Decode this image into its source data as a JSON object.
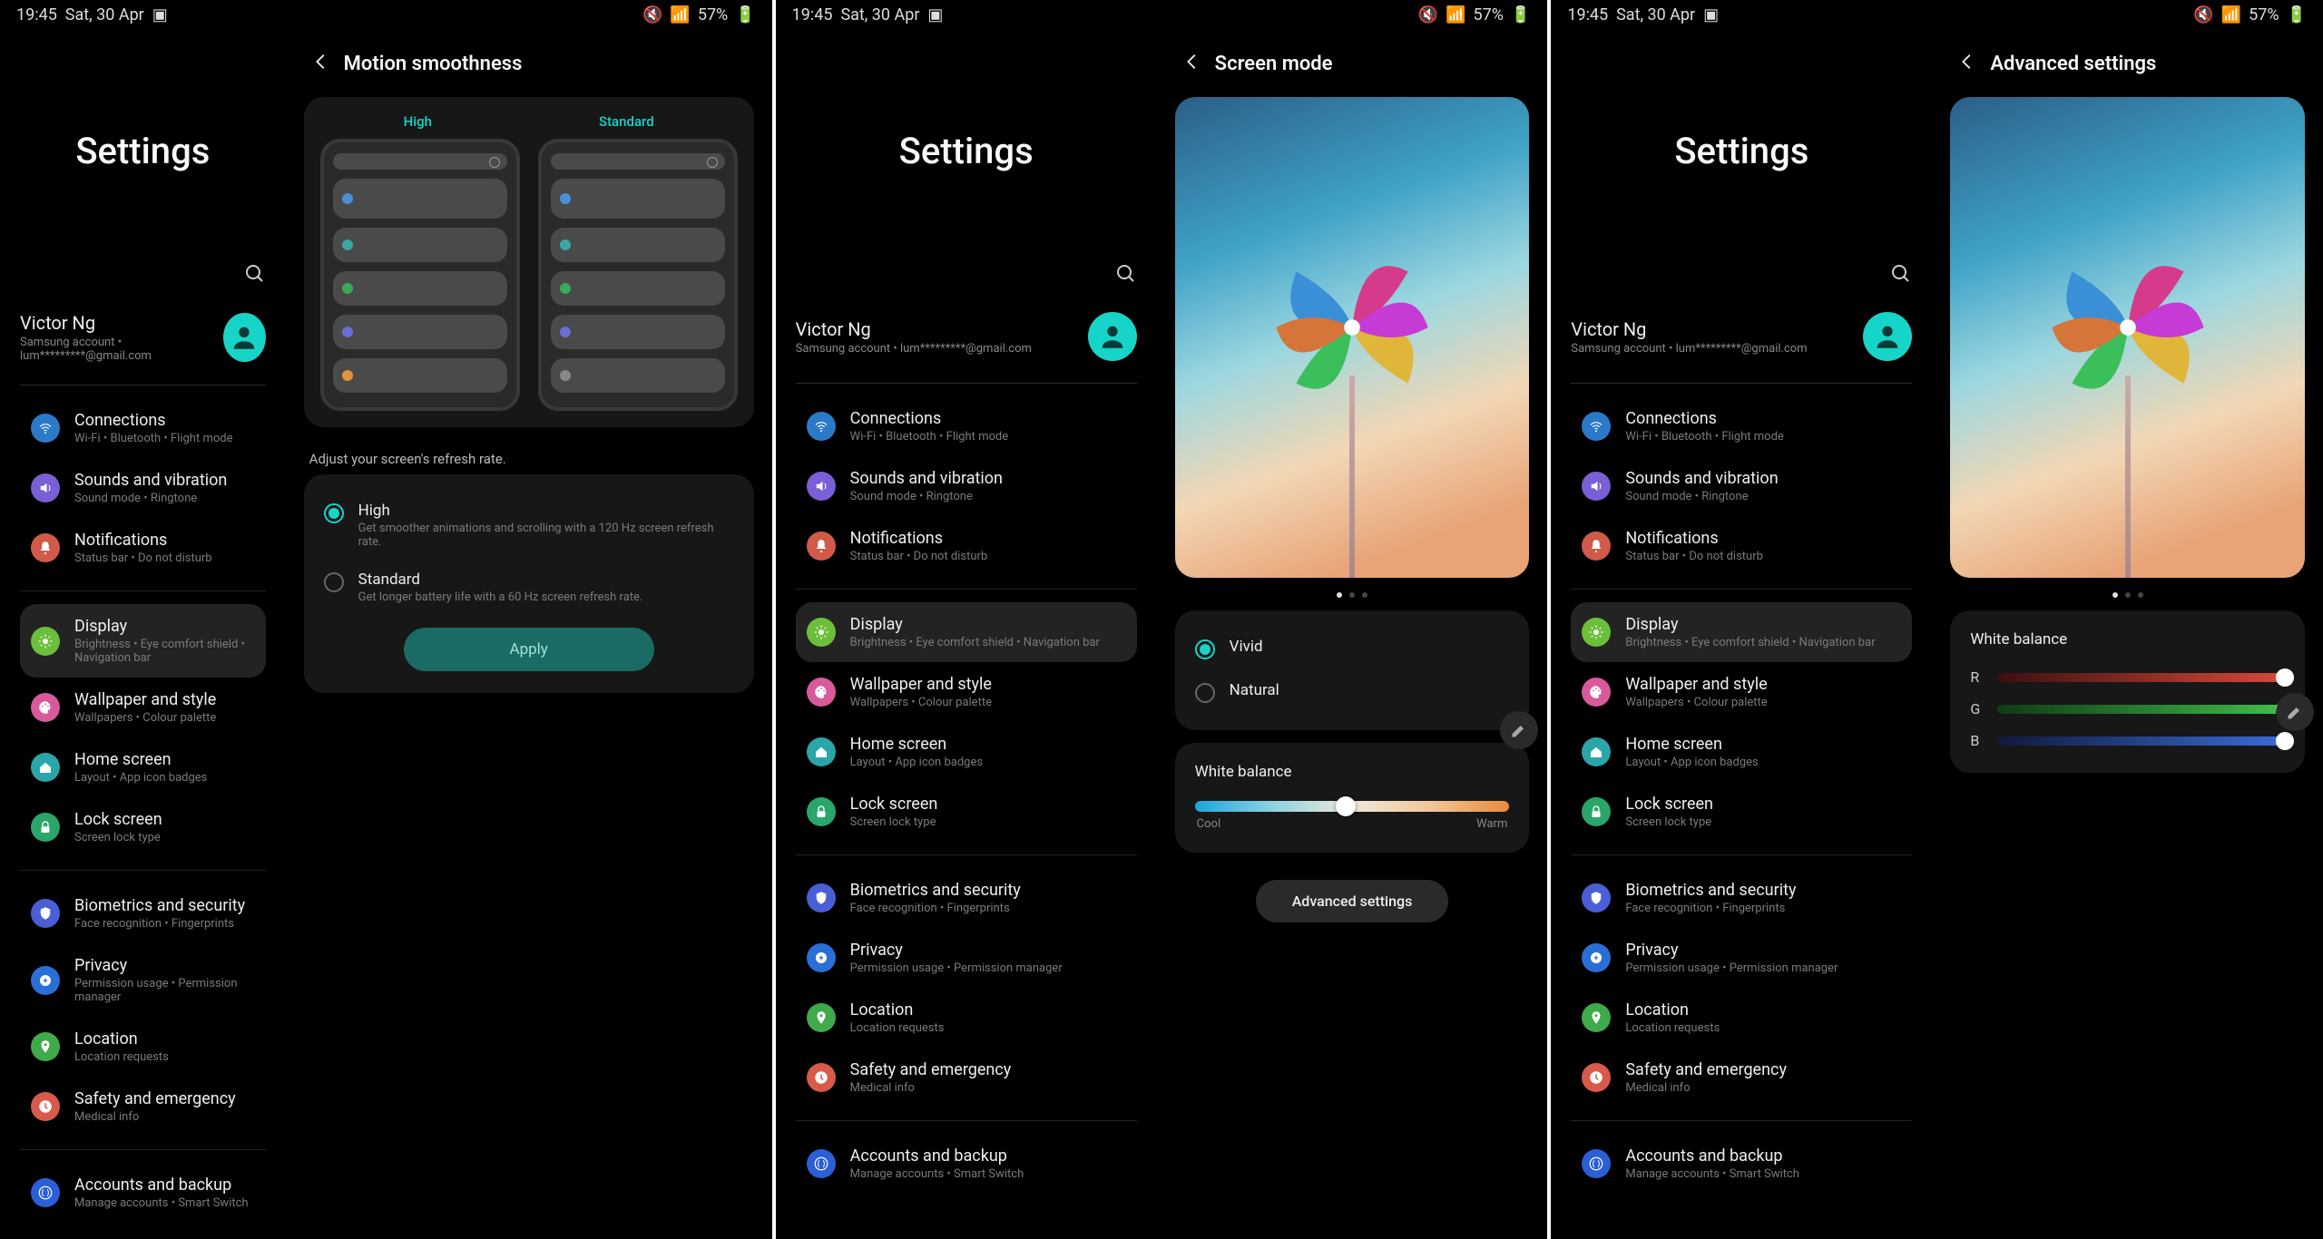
{
  "status": {
    "time": "19:45",
    "date": "Sat, 30 Apr",
    "battery": "57%"
  },
  "sidebar": {
    "title": "Settings",
    "user": {
      "name": "Victor Ng",
      "sub": "Samsung account  •  lum*********@gmail.com"
    },
    "items": [
      {
        "label": "Connections",
        "sub": "Wi-Fi  •  Bluetooth  •  Flight mode",
        "color": "#2a7ac9",
        "icon": "wifi"
      },
      {
        "label": "Sounds and vibration",
        "sub": "Sound mode  •  Ringtone",
        "color": "#7a5fd6",
        "icon": "sound"
      },
      {
        "label": "Notifications",
        "sub": "Status bar  •  Do not disturb",
        "color": "#d15a4a",
        "icon": "bell"
      },
      {
        "label": "Display",
        "sub": "Brightness  •  Eye comfort shield  •  Navigation bar",
        "color": "#6bbf3a",
        "icon": "sun",
        "selected": true
      },
      {
        "label": "Wallpaper and style",
        "sub": "Wallpapers  •  Colour palette",
        "color": "#d85a9a",
        "icon": "palette"
      },
      {
        "label": "Home screen",
        "sub": "Layout  •  App icon badges",
        "color": "#2aa6aa",
        "icon": "home"
      },
      {
        "label": "Lock screen",
        "sub": "Screen lock type",
        "color": "#2aa66a",
        "icon": "lock"
      },
      {
        "label": "Biometrics and security",
        "sub": "Face recognition  •  Fingerprints",
        "color": "#4a5fd6",
        "icon": "shield"
      },
      {
        "label": "Privacy",
        "sub": "Permission usage  •  Permission manager",
        "color": "#2a6fd6",
        "icon": "privacy"
      },
      {
        "label": "Location",
        "sub": "Location requests",
        "color": "#3faa4a",
        "icon": "pin"
      },
      {
        "label": "Safety and emergency",
        "sub": "Medical info",
        "color": "#d85a4a",
        "icon": "safety"
      },
      {
        "label": "Accounts and backup",
        "sub": "Manage accounts  •  Smart Switch",
        "color": "#2a5fd6",
        "icon": "accounts"
      }
    ],
    "dividers_after": [
      2,
      6,
      10
    ]
  },
  "panel1": {
    "title": "Motion smoothness",
    "tabs": [
      "High",
      "Standard"
    ],
    "desc": "Adjust your screen's refresh rate.",
    "options": [
      {
        "title": "High",
        "sub": "Get smoother animations and scrolling with a 120 Hz screen refresh rate.",
        "on": true
      },
      {
        "title": "Standard",
        "sub": "Get longer battery life with a 60 Hz screen refresh rate.",
        "on": false
      }
    ],
    "apply": "Apply"
  },
  "panel2": {
    "title": "Screen mode",
    "options": [
      {
        "title": "Vivid",
        "on": true
      },
      {
        "title": "Natural",
        "on": false
      }
    ],
    "wb_title": "White balance",
    "wb_cool": "Cool",
    "wb_warm": "Warm",
    "adv": "Advanced settings"
  },
  "panel3": {
    "title": "Advanced settings",
    "wb_title": "White balance",
    "channels": [
      "R",
      "G",
      "B"
    ]
  }
}
